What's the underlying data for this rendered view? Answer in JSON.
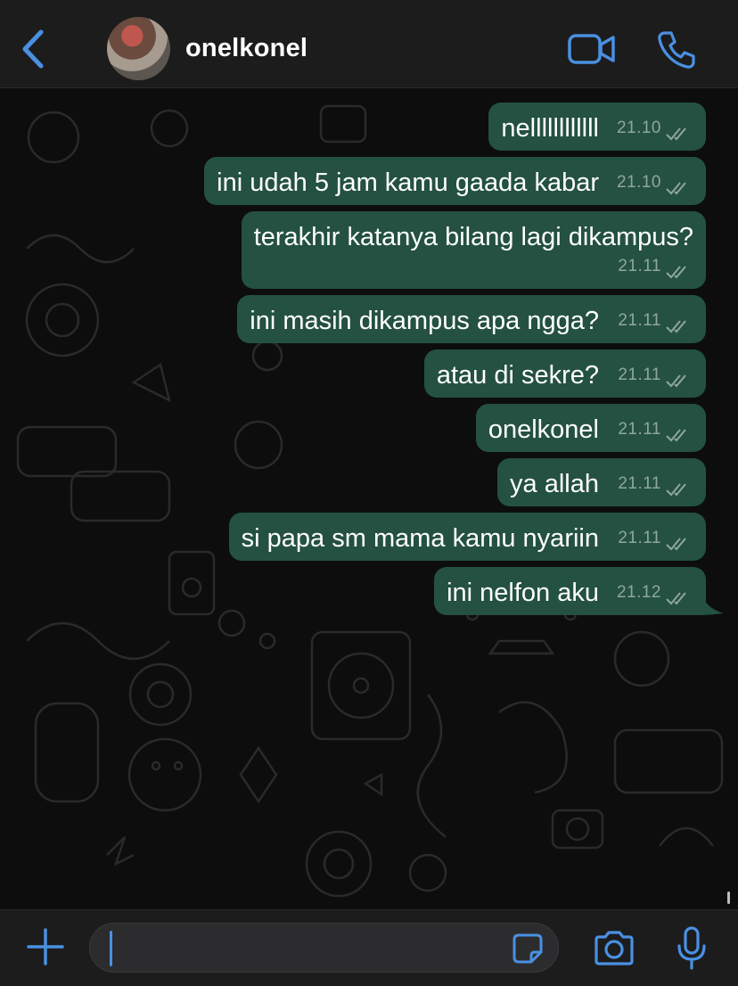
{
  "header": {
    "contact_name": "onelkonel",
    "icons": [
      "back-chevron-icon",
      "video-camera-icon",
      "phone-icon"
    ]
  },
  "messages": [
    {
      "text": "nellllllllllll",
      "time": "21.10",
      "status": "delivered"
    },
    {
      "text": "ini udah 5 jam kamu gaada kabar",
      "time": "21.10",
      "status": "delivered"
    },
    {
      "text": "terakhir katanya bilang lagi dikampus?",
      "time": "21.11",
      "status": "delivered"
    },
    {
      "text": "ini masih dikampus apa ngga?",
      "time": "21.11",
      "status": "delivered"
    },
    {
      "text": "atau di sekre?",
      "time": "21.11",
      "status": "delivered"
    },
    {
      "text": "onelkonel",
      "time": "21.11",
      "status": "delivered"
    },
    {
      "text": "ya allah",
      "time": "21.11",
      "status": "delivered"
    },
    {
      "text": "si papa sm mama kamu nyariin",
      "time": "21.11",
      "status": "delivered"
    },
    {
      "text": "ini nelfon aku",
      "time": "21.12",
      "status": "delivered"
    }
  ],
  "input_bar": {
    "message_value": "",
    "icons": [
      "plus-icon",
      "sticker-icon",
      "camera-icon",
      "microphone-icon"
    ]
  },
  "colors": {
    "accent": "#4a90e2",
    "outgoing_bubble": "#245141",
    "header_bg": "#1c1c1d",
    "chat_bg": "#0d0d0d"
  }
}
